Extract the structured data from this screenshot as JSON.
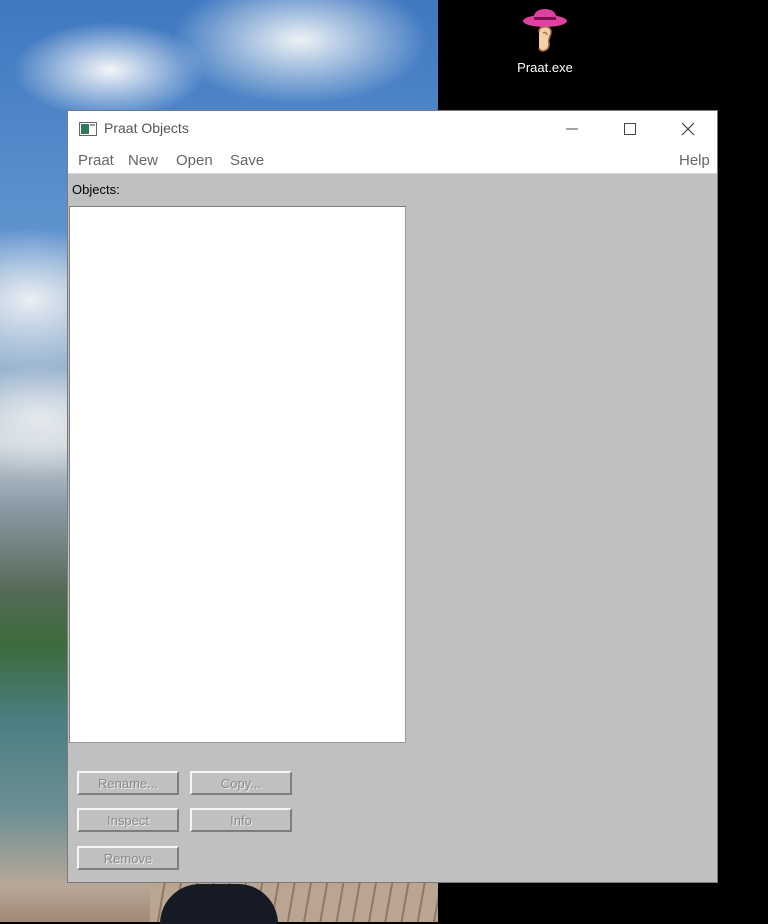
{
  "desktop": {
    "icon_label": "Praat.exe",
    "icon_name": "praat-ear-hat-icon"
  },
  "window": {
    "title": "Praat Objects",
    "controls": {
      "minimize": "minimize-icon",
      "maximize": "maximize-icon",
      "close": "close-icon"
    },
    "menu": [
      "Praat",
      "New",
      "Open",
      "Save"
    ],
    "help": "Help"
  },
  "objects": {
    "label": "Objects:",
    "items": []
  },
  "buttons": {
    "rename": "Rename...",
    "copy": "Copy...",
    "inspect": "Inspect",
    "info": "Info",
    "remove": "Remove"
  },
  "colors": {
    "panel": "#c0c0c0",
    "disabled_text": "#8a8a8a",
    "icon_hat": "#e040a0"
  }
}
